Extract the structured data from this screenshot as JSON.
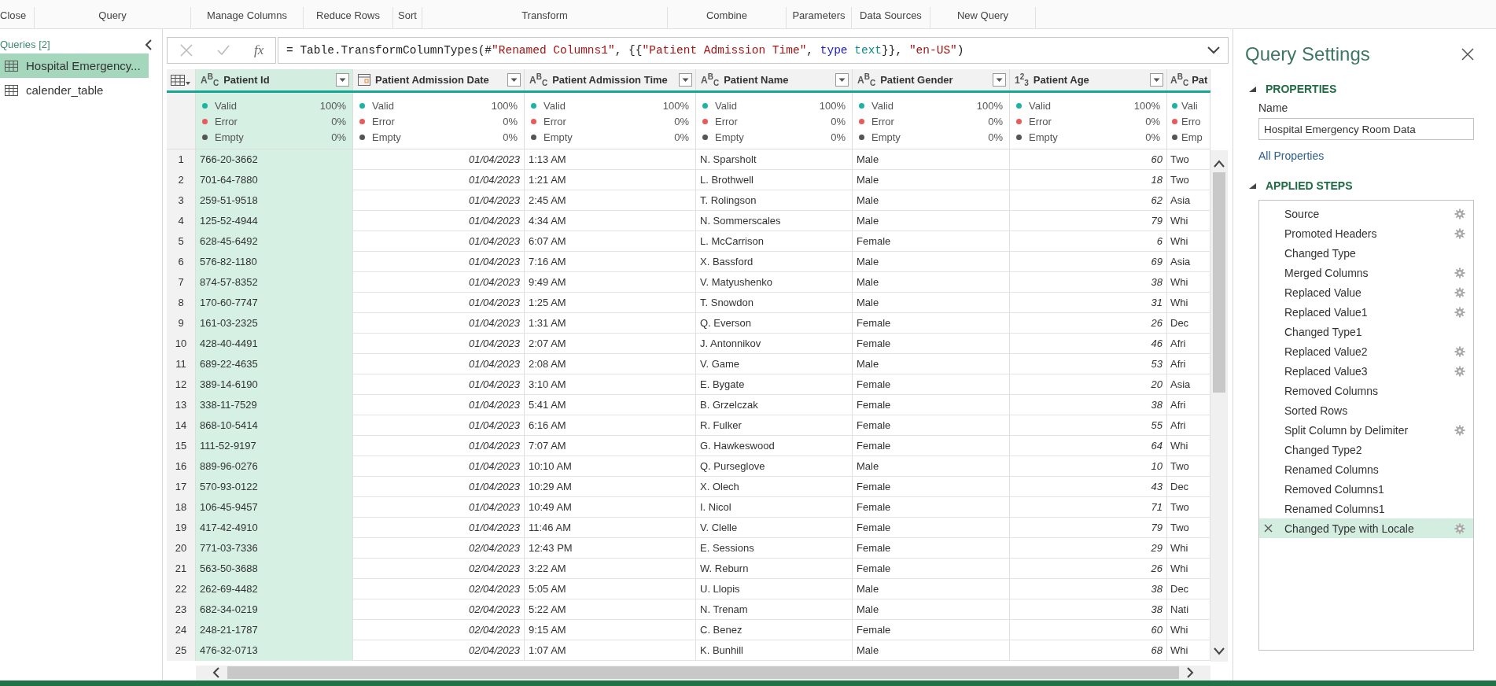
{
  "ribbon": {
    "groups": [
      "Close",
      "Query",
      "Manage Columns",
      "Reduce Rows",
      "Sort",
      "Transform",
      "Combine",
      "Parameters",
      "Data Sources",
      "New Query"
    ]
  },
  "queries_panel": {
    "title": "Queries [2]",
    "items": [
      {
        "label": "Hospital Emergency...",
        "selected": true
      },
      {
        "label": "calender_table",
        "selected": false
      }
    ]
  },
  "formula_bar": {
    "fx_label": "fx",
    "formula": [
      {
        "kind": "plain",
        "text": "= Table.TransformColumnTypes(#"
      },
      {
        "kind": "string",
        "text": "\"Renamed Columns1\""
      },
      {
        "kind": "plain",
        "text": ", {{"
      },
      {
        "kind": "string",
        "text": "\"Patient Admission Time\""
      },
      {
        "kind": "plain",
        "text": ", "
      },
      {
        "kind": "keyword",
        "text": "type"
      },
      {
        "kind": "type",
        "text": " text"
      },
      {
        "kind": "plain",
        "text": "}}, "
      },
      {
        "kind": "string",
        "text": "\"en-US\""
      },
      {
        "kind": "plain",
        "text": ")"
      }
    ]
  },
  "table": {
    "columns": [
      {
        "name": "Patient Id",
        "kind": "text",
        "type_label": "A$^{B}$$_{C}$",
        "selected": true,
        "filter_button": true,
        "quality": [
          {
            "label": "Valid",
            "value": "100%",
            "color": "#1db3a3"
          },
          {
            "label": "Error",
            "value": "0%",
            "color": "#e85b5b"
          },
          {
            "label": "Empty",
            "value": "0%",
            "color": "#555555"
          }
        ]
      },
      {
        "name": "Patient Admission Date",
        "kind": "date",
        "selected": false,
        "filter_button": true,
        "quality": [
          {
            "label": "Valid",
            "value": "100%",
            "color": "#1db3a3"
          },
          {
            "label": "Error",
            "value": "0%",
            "color": "#e85b5b"
          },
          {
            "label": "Empty",
            "value": "0%",
            "color": "#555555"
          }
        ]
      },
      {
        "name": "Patient Admission Time",
        "kind": "text",
        "type_label": "A$^{B}$$_{C}$",
        "selected": false,
        "filter_button": true,
        "quality": [
          {
            "label": "Valid",
            "value": "100%",
            "color": "#1db3a3"
          },
          {
            "label": "Error",
            "value": "0%",
            "color": "#e85b5b"
          },
          {
            "label": "Empty",
            "value": "0%",
            "color": "#555555"
          }
        ]
      },
      {
        "name": "Patient Name",
        "kind": "text",
        "type_label": "A$^{B}$$_{C}$",
        "selected": false,
        "filter_button": true,
        "quality": [
          {
            "label": "Valid",
            "value": "100%",
            "color": "#1db3a3"
          },
          {
            "label": "Error",
            "value": "0%",
            "color": "#e85b5b"
          },
          {
            "label": "Empty",
            "value": "0%",
            "color": "#555555"
          }
        ]
      },
      {
        "name": "Patient Gender",
        "kind": "text",
        "type_label": "A$^{B}$$_{C}$",
        "selected": false,
        "filter_button": true,
        "quality": [
          {
            "label": "Valid",
            "value": "100%",
            "color": "#1db3a3"
          },
          {
            "label": "Error",
            "value": "0%",
            "color": "#e85b5b"
          },
          {
            "label": "Empty",
            "value": "0%",
            "color": "#555555"
          }
        ]
      },
      {
        "name": "Patient Age",
        "kind": "number",
        "type_label": "1$^{2}$$_{3}$",
        "selected": false,
        "filter_button": true,
        "quality": [
          {
            "label": "Valid",
            "value": "100%",
            "color": "#1db3a3"
          },
          {
            "label": "Error",
            "value": "0%",
            "color": "#e85b5b"
          },
          {
            "label": "Empty",
            "value": "0%",
            "color": "#555555"
          }
        ]
      },
      {
        "name": "Pat",
        "kind": "text",
        "type_label": "A$^{B}$$_{C}$",
        "selected": false,
        "filter_button": false,
        "quality": [
          {
            "label": "Vali",
            "color": "#1db3a3"
          },
          {
            "label": "Erro",
            "color": "#e85b5b"
          },
          {
            "label": "Emp",
            "color": "#555555"
          }
        ]
      }
    ],
    "rows": [
      {
        "number": "1",
        "cells": [
          "766-20-3662",
          "01/04/2023",
          "1:13 AM",
          "N. Sparsholt",
          "Male",
          "60",
          "Two"
        ]
      },
      {
        "number": "2",
        "cells": [
          "701-64-7880",
          "01/04/2023",
          "1:21 AM",
          "L. Brothwell",
          "Male",
          "18",
          "Two"
        ]
      },
      {
        "number": "3",
        "cells": [
          "259-51-9518",
          "01/04/2023",
          "2:45 AM",
          "T. Rolingson",
          "Male",
          "62",
          "Asia"
        ]
      },
      {
        "number": "4",
        "cells": [
          "125-52-4944",
          "01/04/2023",
          "4:34 AM",
          "N. Sommerscales",
          "Male",
          "79",
          "Whi"
        ]
      },
      {
        "number": "5",
        "cells": [
          "628-45-6492",
          "01/04/2023",
          "6:07 AM",
          "L. McCarrison",
          "Female",
          "6",
          "Whi"
        ]
      },
      {
        "number": "6",
        "cells": [
          "576-82-1180",
          "01/04/2023",
          "7:16 AM",
          "X. Bassford",
          "Male",
          "69",
          "Asia"
        ]
      },
      {
        "number": "7",
        "cells": [
          "874-57-8352",
          "01/04/2023",
          "9:49 AM",
          "V. Matyushenko",
          "Male",
          "38",
          "Whi"
        ]
      },
      {
        "number": "8",
        "cells": [
          "170-60-7747",
          "01/04/2023",
          "1:25 AM",
          "T. Snowdon",
          "Male",
          "31",
          "Whi"
        ]
      },
      {
        "number": "9",
        "cells": [
          "161-03-2325",
          "01/04/2023",
          "1:31 AM",
          "Q. Everson",
          "Female",
          "26",
          "Dec"
        ]
      },
      {
        "number": "10",
        "cells": [
          "428-40-4491",
          "01/04/2023",
          "2:07 AM",
          "J. Antonnikov",
          "Female",
          "46",
          "Afri"
        ]
      },
      {
        "number": "11",
        "cells": [
          "689-22-4635",
          "01/04/2023",
          "2:08 AM",
          "V. Game",
          "Male",
          "53",
          "Afri"
        ]
      },
      {
        "number": "12",
        "cells": [
          "389-14-6190",
          "01/04/2023",
          "3:10 AM",
          "E. Bygate",
          "Female",
          "20",
          "Asia"
        ]
      },
      {
        "number": "13",
        "cells": [
          "338-11-7529",
          "01/04/2023",
          "5:41 AM",
          "B. Grzelczak",
          "Female",
          "38",
          "Afri"
        ]
      },
      {
        "number": "14",
        "cells": [
          "868-10-5414",
          "01/04/2023",
          "6:16 AM",
          "R. Fulker",
          "Female",
          "55",
          "Afri"
        ]
      },
      {
        "number": "15",
        "cells": [
          "111-52-9197",
          "01/04/2023",
          "7:07 AM",
          "G. Hawkeswood",
          "Female",
          "64",
          "Whi"
        ]
      },
      {
        "number": "16",
        "cells": [
          "889-96-0276",
          "01/04/2023",
          "10:10 AM",
          "Q. Purseglove",
          "Male",
          "10",
          "Two"
        ]
      },
      {
        "number": "17",
        "cells": [
          "570-93-0122",
          "01/04/2023",
          "10:29 AM",
          "X. Olech",
          "Female",
          "43",
          "Dec"
        ]
      },
      {
        "number": "18",
        "cells": [
          "106-45-9457",
          "01/04/2023",
          "10:49 AM",
          "I. Nicol",
          "Female",
          "71",
          "Two"
        ]
      },
      {
        "number": "19",
        "cells": [
          "417-42-4910",
          "01/04/2023",
          "11:46 AM",
          "V. Clelle",
          "Female",
          "79",
          "Two"
        ]
      },
      {
        "number": "20",
        "cells": [
          "771-03-7336",
          "02/04/2023",
          "12:43 PM",
          "E. Sessions",
          "Female",
          "29",
          "Whi"
        ]
      },
      {
        "number": "21",
        "cells": [
          "563-50-3688",
          "02/04/2023",
          "3:22 AM",
          "W. Reburn",
          "Female",
          "26",
          "Whi"
        ]
      },
      {
        "number": "22",
        "cells": [
          "262-69-4482",
          "02/04/2023",
          "5:05 AM",
          "U. Llopis",
          "Male",
          "38",
          "Dec"
        ]
      },
      {
        "number": "23",
        "cells": [
          "682-34-0219",
          "02/04/2023",
          "5:22 AM",
          "N. Trenam",
          "Male",
          "38",
          "Nati"
        ]
      },
      {
        "number": "24",
        "cells": [
          "248-21-1787",
          "02/04/2023",
          "9:15 AM",
          "C. Benez",
          "Female",
          "60",
          "Whi"
        ]
      },
      {
        "number": "25",
        "cells": [
          "476-32-0713",
          "02/04/2023",
          "1:07 AM",
          "K. Bunhill",
          "Male",
          "68",
          "Whi"
        ]
      }
    ]
  },
  "query_settings": {
    "title": "Query Settings",
    "properties_heading": "PROPERTIES",
    "name_label": "Name",
    "name_value": "Hospital Emergency Room Data",
    "all_properties_link": "All Properties",
    "steps_heading": "APPLIED STEPS",
    "steps": [
      {
        "name": "Source",
        "has_settings": true,
        "selected": false
      },
      {
        "name": "Promoted Headers",
        "has_settings": true,
        "selected": false
      },
      {
        "name": "Changed Type",
        "has_settings": false,
        "selected": false
      },
      {
        "name": "Merged Columns",
        "has_settings": true,
        "selected": false
      },
      {
        "name": "Replaced Value",
        "has_settings": true,
        "selected": false
      },
      {
        "name": "Replaced Value1",
        "has_settings": true,
        "selected": false
      },
      {
        "name": "Changed Type1",
        "has_settings": false,
        "selected": false
      },
      {
        "name": "Replaced Value2",
        "has_settings": true,
        "selected": false
      },
      {
        "name": "Replaced Value3",
        "has_settings": true,
        "selected": false
      },
      {
        "name": "Removed Columns",
        "has_settings": false,
        "selected": false
      },
      {
        "name": "Sorted Rows",
        "has_settings": false,
        "selected": false
      },
      {
        "name": "Split Column by Delimiter",
        "has_settings": true,
        "selected": false
      },
      {
        "name": "Changed Type2",
        "has_settings": false,
        "selected": false
      },
      {
        "name": "Renamed Columns",
        "has_settings": false,
        "selected": false
      },
      {
        "name": "Removed Columns1",
        "has_settings": false,
        "selected": false
      },
      {
        "name": "Renamed Columns1",
        "has_settings": false,
        "selected": false
      },
      {
        "name": "Changed Type with Locale",
        "has_settings": true,
        "selected": true
      }
    ]
  }
}
